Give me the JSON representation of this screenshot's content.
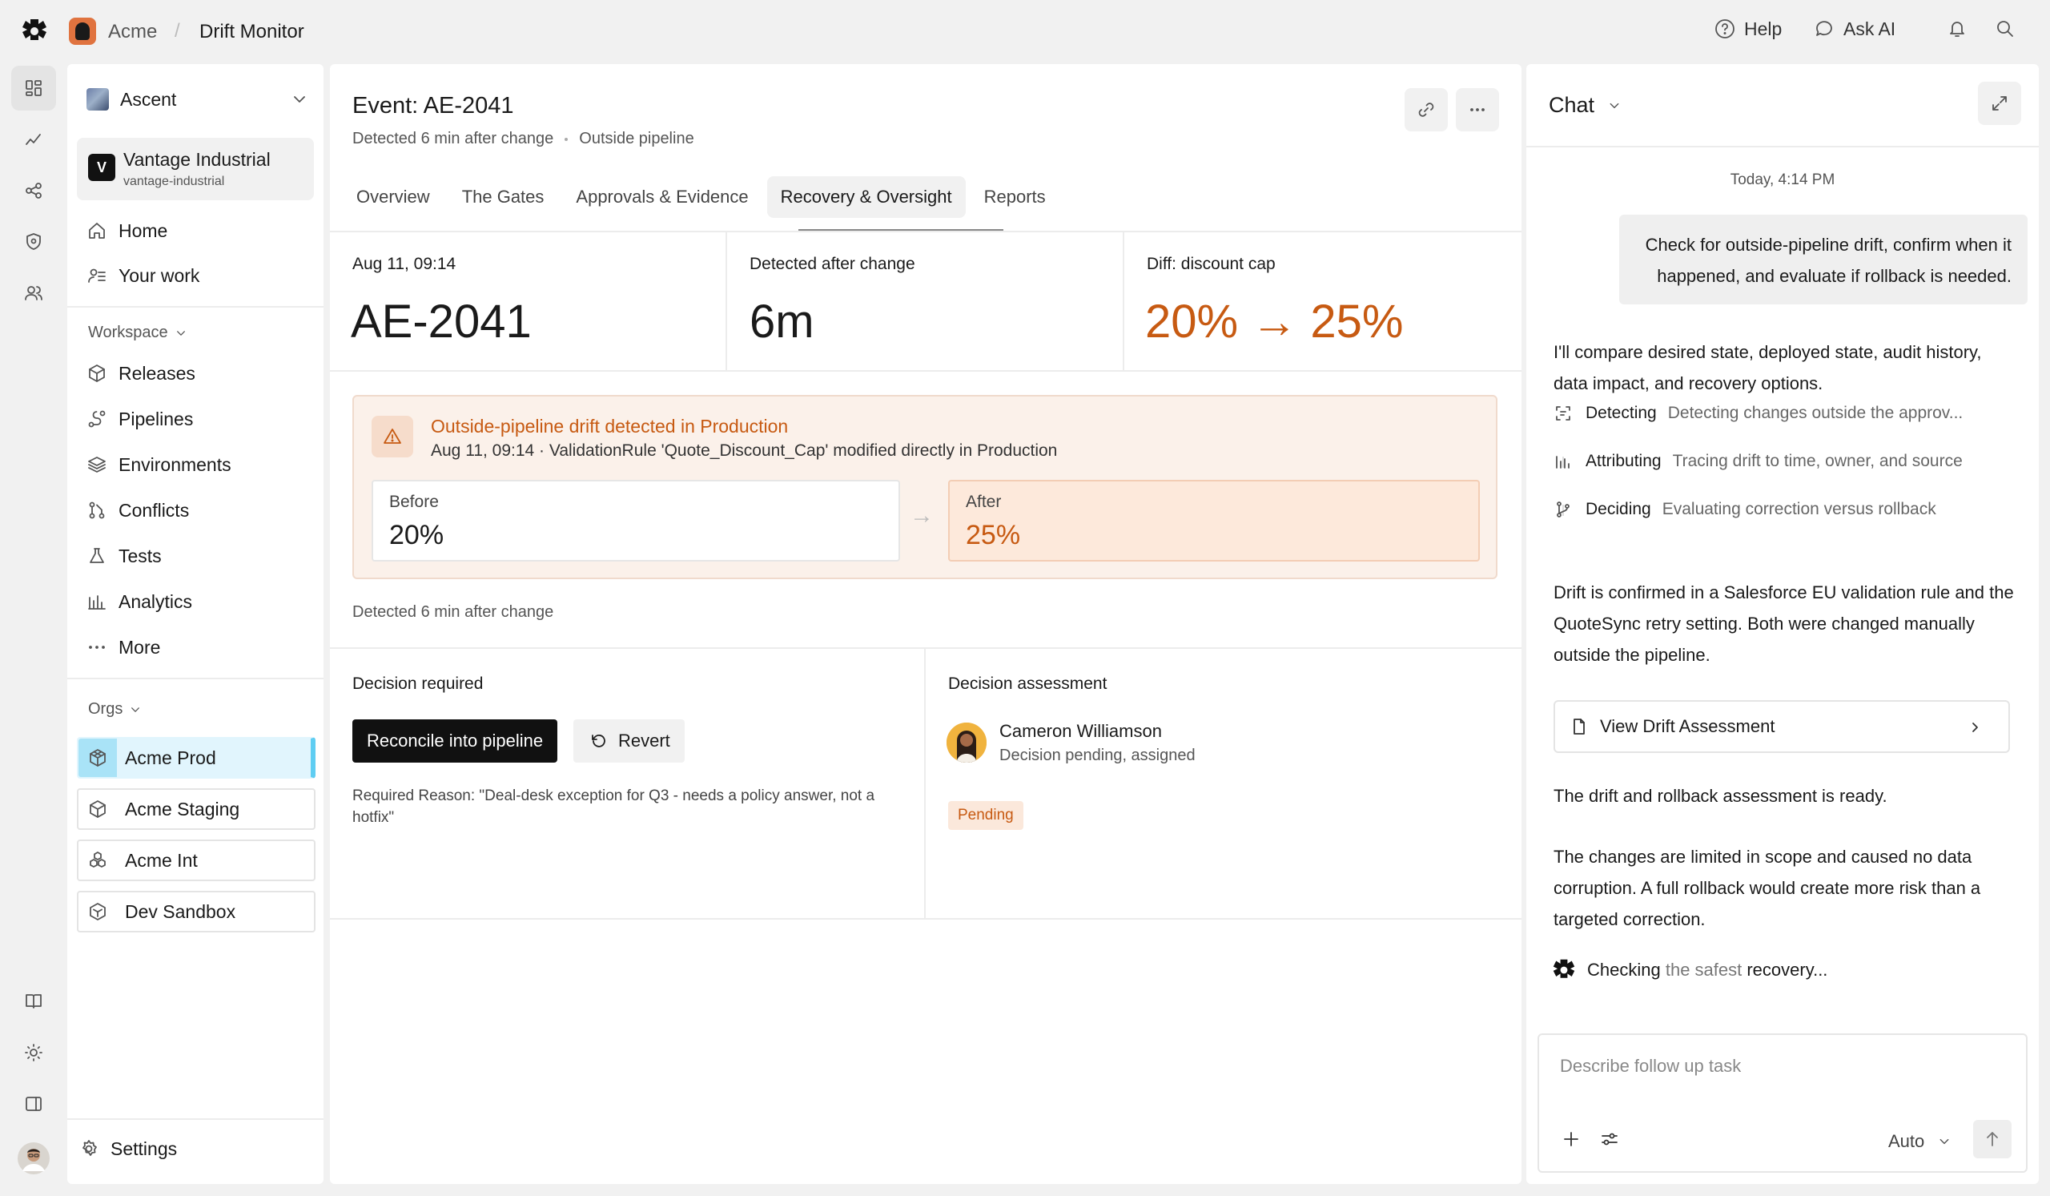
{
  "breadcrumb": {
    "app": "Acme",
    "separator": "/",
    "page": "Drift Monitor"
  },
  "topbar": {
    "help": "Help",
    "ask_ai": "Ask AI"
  },
  "sidebar": {
    "workspace_switcher": "Ascent",
    "org": {
      "badge": "V",
      "name": "Vantage Industrial",
      "slug": "vantage-industrial"
    },
    "primary": [
      {
        "label": "Home",
        "icon": "home-icon"
      },
      {
        "label": "Your work",
        "icon": "list-icon"
      }
    ],
    "workspace_label": "Workspace",
    "workspace_items": [
      {
        "label": "Releases",
        "icon": "box-icon"
      },
      {
        "label": "Pipelines",
        "icon": "pipeline-icon"
      },
      {
        "label": "Environments",
        "icon": "layers-icon"
      },
      {
        "label": "Conflicts",
        "icon": "conflict-icon"
      },
      {
        "label": "Tests",
        "icon": "flask-icon"
      },
      {
        "label": "Analytics",
        "icon": "bar-chart-icon"
      },
      {
        "label": "More",
        "icon": "more-dots-icon"
      }
    ],
    "orgs_label": "Orgs",
    "orgs": [
      {
        "label": "Acme Prod",
        "active": true
      },
      {
        "label": "Acme Staging",
        "active": false
      },
      {
        "label": "Acme Int",
        "active": false
      },
      {
        "label": "Dev Sandbox",
        "active": false
      }
    ],
    "settings": "Settings"
  },
  "event": {
    "title": "Event: AE-2041",
    "meta_detected": "Detected 6 min after change",
    "meta_source": "Outside pipeline",
    "tabs": [
      {
        "label": "Overview",
        "active": false
      },
      {
        "label": "The Gates",
        "active": false
      },
      {
        "label": "Approvals & Evidence",
        "active": false
      },
      {
        "label": "Recovery & Oversight",
        "active": true
      },
      {
        "label": "Reports",
        "active": false
      }
    ],
    "stats": [
      {
        "label": "Aug 11, 09:14",
        "value": "AE-2041"
      },
      {
        "label": "Detected after change",
        "value": "6m"
      },
      {
        "label": "Diff: discount cap",
        "value": "20% → 25%"
      }
    ],
    "alert": {
      "title": "Outside-pipeline drift detected in Production",
      "description": "Aug 11, 09:14 · ValidationRule 'Quote_Discount_Cap' modified directly in Production",
      "before_label": "Before",
      "before_value": "20%",
      "after_label": "After",
      "after_value": "25%",
      "arrow": "→"
    },
    "detected_note": "Detected 6 min after change",
    "decision": {
      "title": "Decision required",
      "primary_action": "Reconcile into pipeline",
      "secondary_action": "Revert",
      "reason": "Required Reason: \"Deal-desk exception for Q3 - needs a policy answer, not a hotfix\""
    },
    "assessment": {
      "title": "Decision assessment",
      "assessor": "Cameron Williamson",
      "status": "Decision pending, assigned",
      "badge": "Pending"
    }
  },
  "chat": {
    "title": "Chat",
    "timestamp": "Today, 4:14 PM",
    "user_message": "Check for outside-pipeline drift, confirm when it happened, and evaluate if rollback is needed.",
    "reply_intro": "I'll compare desired state, deployed state, audit history, data impact, and recovery options.",
    "steps": [
      {
        "name": "Detecting",
        "desc": "Detecting changes outside the approv..."
      },
      {
        "name": "Attributing",
        "desc": "Tracing drift to time, owner, and source"
      },
      {
        "name": "Deciding",
        "desc": "Evaluating correction versus rollback"
      }
    ],
    "finding": "Drift is confirmed in a Salesforce EU validation rule and the QuoteSync retry setting. Both were changed manually outside the pipeline.",
    "card_label": "View Drift Assessment",
    "ready": "The drift and rollback assessment is ready.",
    "summary": "The changes are limited in scope and caused no data corruption. A full rollback would create more risk than a targeted correction.",
    "checking_a": "Checking",
    "checking_b": "the safest",
    "checking_c": "recovery...",
    "composer_placeholder": "Describe follow up task",
    "model": "Auto"
  },
  "colors": {
    "accent_orange": "#c75a12",
    "active_org": "#e1f5fd",
    "active_org_bar": "#5fcdf2"
  }
}
